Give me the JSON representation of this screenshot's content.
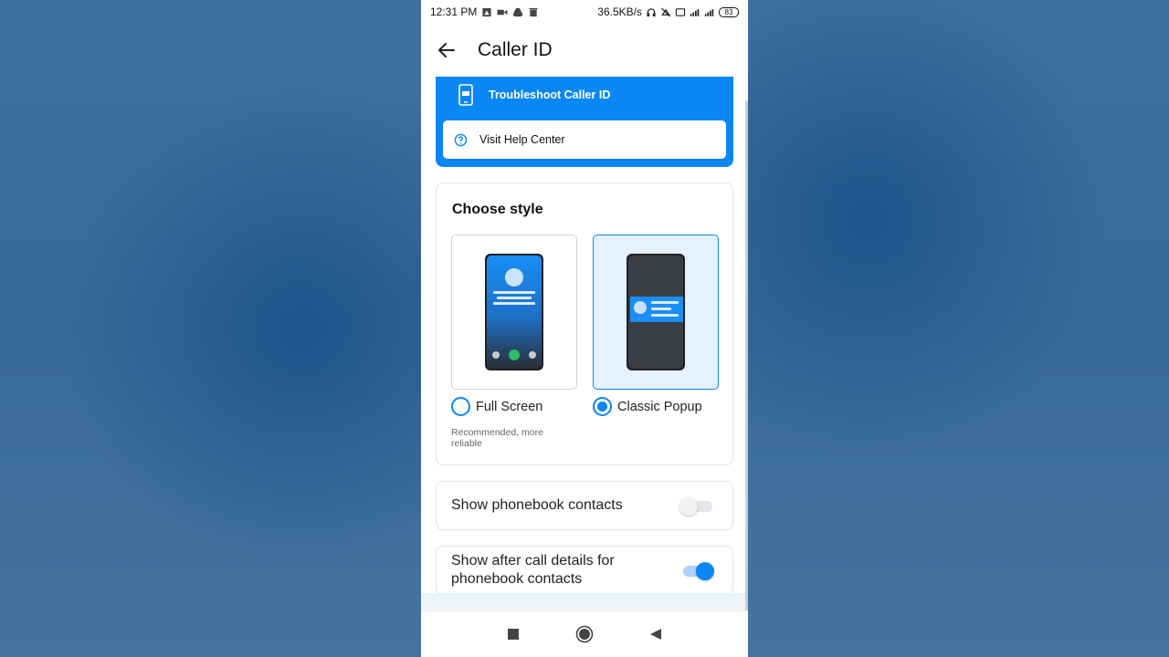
{
  "status_bar": {
    "time": "12:31 PM",
    "speed": "36.5KB/s",
    "battery": "83"
  },
  "app_bar": {
    "title": "Caller ID"
  },
  "troubleshoot": {
    "label": "Troubleshoot Caller ID",
    "help_label": "Visit Help Center"
  },
  "style": {
    "title": "Choose style",
    "options": [
      {
        "label": "Full Screen",
        "note": "Recommended, more reliable",
        "selected": false
      },
      {
        "label": "Classic Popup",
        "selected": true
      }
    ]
  },
  "toggles": [
    {
      "label": "Show phonebook contacts",
      "on": false
    },
    {
      "label": "Show after call details for phonebook contacts",
      "on": true
    }
  ],
  "colors": {
    "accent": "#0a87f2",
    "selected_bg": "#e5f2fe"
  },
  "icons": {
    "back": "arrow-left-icon",
    "troubleshoot": "phone-card-icon",
    "help": "help-circle-icon",
    "nav_recents": "square-icon",
    "nav_home": "circle-icon",
    "nav_back": "triangle-back-icon"
  }
}
